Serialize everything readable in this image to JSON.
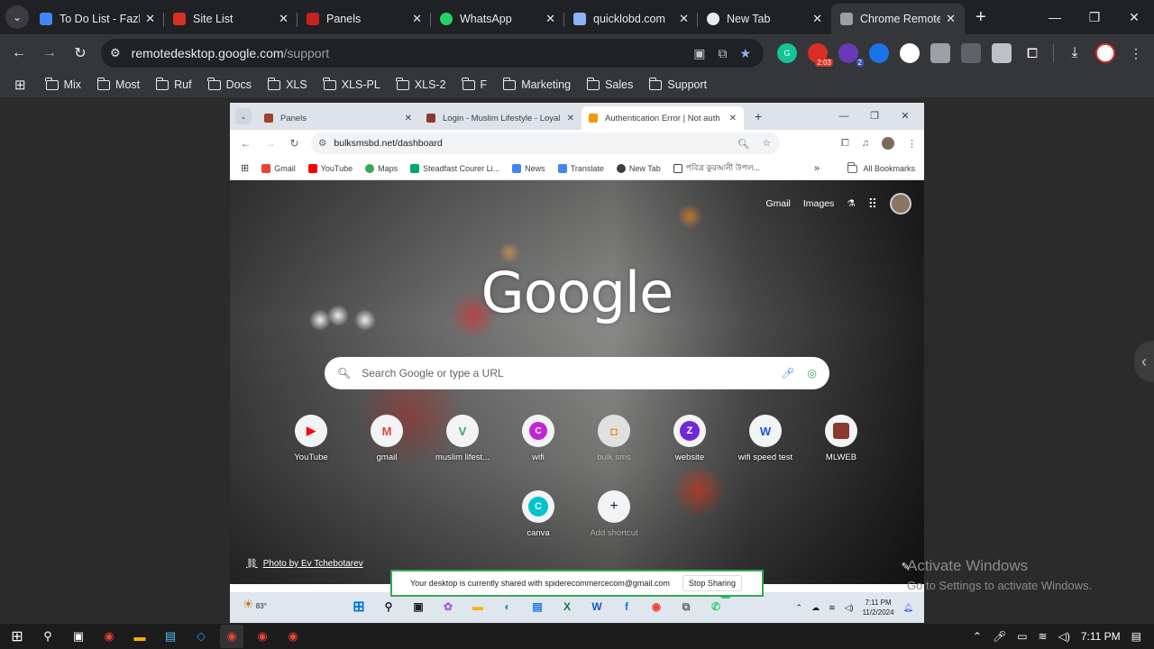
{
  "window": {
    "tabs": [
      {
        "title": "To Do List - Fazle",
        "color": "#4285f4"
      },
      {
        "title": "Site List",
        "color": "#d93025"
      },
      {
        "title": "Panels",
        "color": "#c5221f"
      },
      {
        "title": "WhatsApp",
        "color": "#25d366"
      },
      {
        "title": "quicklobd.com",
        "color": "#8ab4f8"
      },
      {
        "title": "New Tab",
        "color": "#e8eaed"
      },
      {
        "title": "Chrome Remote",
        "color": "#9aa0a6"
      }
    ],
    "url_host": "remotedesktop.google.com",
    "url_path": "/support",
    "bookmarks": [
      "Mix",
      "Most",
      "Ruf",
      "Docs",
      "XLS",
      "XLS-PL",
      "XLS-2",
      "F",
      "Marketing",
      "Sales",
      "Support"
    ],
    "extension_badge": "2:03",
    "extension_badge_2": "2"
  },
  "remote_browser": {
    "tabs": [
      {
        "title": "Panels",
        "color": "#a04030"
      },
      {
        "title": "Login - Muslim Lifestyle - Loyal",
        "color": "#8b3a2e"
      },
      {
        "title": "Authentication Error | Not auth",
        "color": "#f29900"
      }
    ],
    "url": "bulksmsbd.net/dashboard",
    "bookmarks": [
      {
        "label": "Gmail",
        "color": "#ea4335"
      },
      {
        "label": "YouTube",
        "color": "#ff0000"
      },
      {
        "label": "Maps",
        "color": "#34a853"
      },
      {
        "label": "Steadfast Courer Li...",
        "color": "#00a86b"
      },
      {
        "label": "News",
        "color": "#4285f4"
      },
      {
        "label": "Translate",
        "color": "#4285f4"
      },
      {
        "label": "New Tab",
        "color": "#3c4043"
      },
      {
        "label": "পবিত্র কুরআনী উপল...",
        "color": "#3c4043"
      }
    ],
    "all_bookmarks": "All Bookmarks"
  },
  "new_tab_page": {
    "links": {
      "gmail": "Gmail",
      "images": "Images"
    },
    "logo": "Google",
    "search_placeholder": "Search Google or type a URL",
    "shortcuts": [
      {
        "label": "YouTube",
        "glyph": "▶",
        "color": "#ff0000"
      },
      {
        "label": "gmail",
        "glyph": "M",
        "color": "#ea4335"
      },
      {
        "label": "muslim lifest...",
        "glyph": "V",
        "color": "#34a853"
      },
      {
        "label": "wifi",
        "glyph": "C",
        "color": "#c026d3"
      },
      {
        "label": "bulk sms",
        "glyph": "◘",
        "color": "#f29900"
      },
      {
        "label": "website",
        "glyph": "Z",
        "color": "#6d28d9"
      },
      {
        "label": "wifi speed test",
        "glyph": "W",
        "color": "#1a56db"
      },
      {
        "label": "MLWEB",
        "glyph": "■",
        "color": "#8b3a2e"
      },
      {
        "label": "canva",
        "glyph": "C",
        "color": "#00c4cc"
      },
      {
        "label": "Add shortcut",
        "glyph": "+",
        "color": "#202124"
      }
    ],
    "photo_credit": "Photo by Ev Tchebotarev"
  },
  "sharing_bar": {
    "message": "Your desktop is currently shared with spiderecommercecom@gmail.com",
    "stop_button": "Stop Sharing"
  },
  "remote_taskbar": {
    "temperature": "83°",
    "whatsapp_badge": "33",
    "time": "7:11 PM",
    "date": "11/2/2024"
  },
  "activate_windows": {
    "title": "Activate Windows",
    "subtitle": "Go to Settings to activate Windows."
  },
  "host_taskbar": {
    "time": "7:11 PM"
  }
}
